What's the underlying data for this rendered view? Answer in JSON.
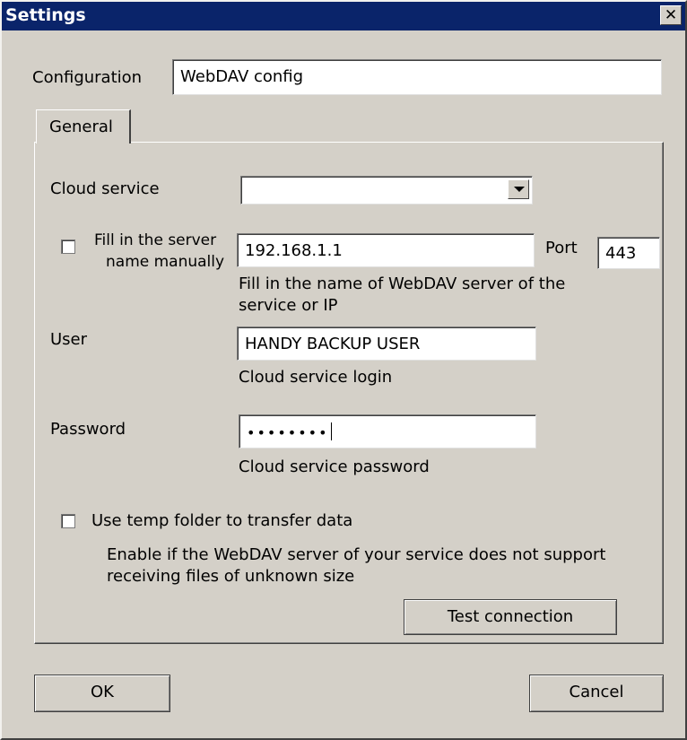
{
  "window": {
    "title": "Settings",
    "close_glyph": "✕"
  },
  "configuration": {
    "label": "Configuration",
    "value": "WebDAV config"
  },
  "tabs": [
    {
      "label": "General",
      "active": true
    }
  ],
  "general": {
    "cloud_service": {
      "label": "Cloud service",
      "value": ""
    },
    "server_manual": {
      "label_line1": "Fill in the server",
      "label_line2": "name manually",
      "checked": false
    },
    "server": {
      "value": "192.168.1.1",
      "hint_line1": "Fill in the name of WebDAV server of the",
      "hint_line2": "service or IP"
    },
    "port": {
      "label": "Port",
      "value": "443"
    },
    "user": {
      "label": "User",
      "value": "HANDY BACKUP USER",
      "hint": "Cloud service login"
    },
    "password": {
      "label": "Password",
      "masked_value": "••••••••",
      "hint": "Cloud service password"
    },
    "temp_folder": {
      "label": "Use temp folder to transfer data",
      "checked": false,
      "desc_line1": "Enable if the WebDAV server of your service does not support",
      "desc_line2": "receiving files of unknown size"
    },
    "test_button": "Test connection"
  },
  "footer": {
    "ok": "OK",
    "cancel": "Cancel"
  },
  "colors": {
    "title_bar": "#0a246a",
    "dialog_bg": "#d4d0c8"
  }
}
